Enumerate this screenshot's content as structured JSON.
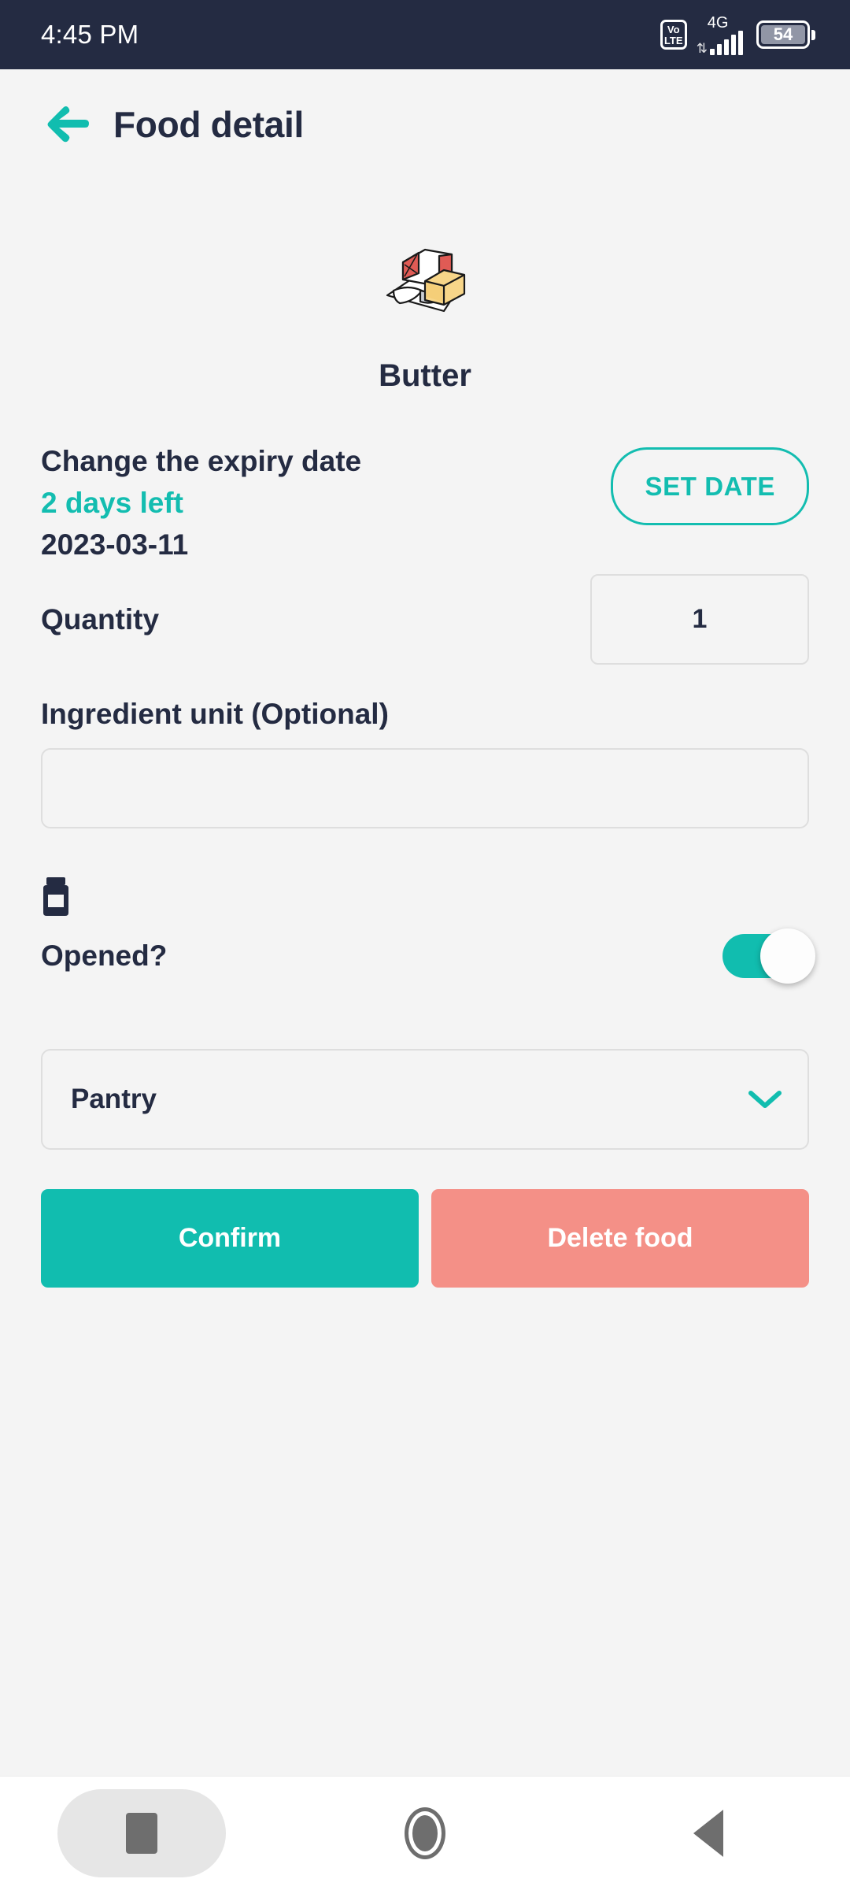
{
  "statusbar": {
    "time": "4:45 PM",
    "volte_top": "Vo",
    "volte_bottom": "LTE",
    "network": "4G",
    "data_arrows": "⇅",
    "battery_level": "54"
  },
  "appbar": {
    "back_icon": "arrow-left-icon",
    "title": "Food detail"
  },
  "food": {
    "icon": "butter-illustration",
    "name": "Butter"
  },
  "expiry": {
    "label": "Change the expiry date",
    "days_left": "2 days left",
    "date": "2023-03-11",
    "set_date_button": "SET DATE"
  },
  "quantity": {
    "label": "Quantity",
    "value": "1"
  },
  "ingredient_unit": {
    "label": "Ingredient unit (Optional)",
    "value": "",
    "placeholder": ""
  },
  "opened": {
    "icon": "jar-icon",
    "label": "Opened?",
    "toggle_state": "on"
  },
  "storage": {
    "selected": "Pantry",
    "chevron_icon": "chevron-down-icon"
  },
  "actions": {
    "confirm_label": "Confirm",
    "delete_label": "Delete food"
  },
  "navbar": {
    "recents_icon": "square-recents-icon",
    "home_icon": "circle-home-icon",
    "back_icon": "triangle-back-icon"
  },
  "colors": {
    "accent_teal": "#11BDAF",
    "dark_navy": "#242B42",
    "delete_salmon": "#F49087",
    "page_bg": "#F4F4F4",
    "border_gray": "#DEDEDE"
  }
}
